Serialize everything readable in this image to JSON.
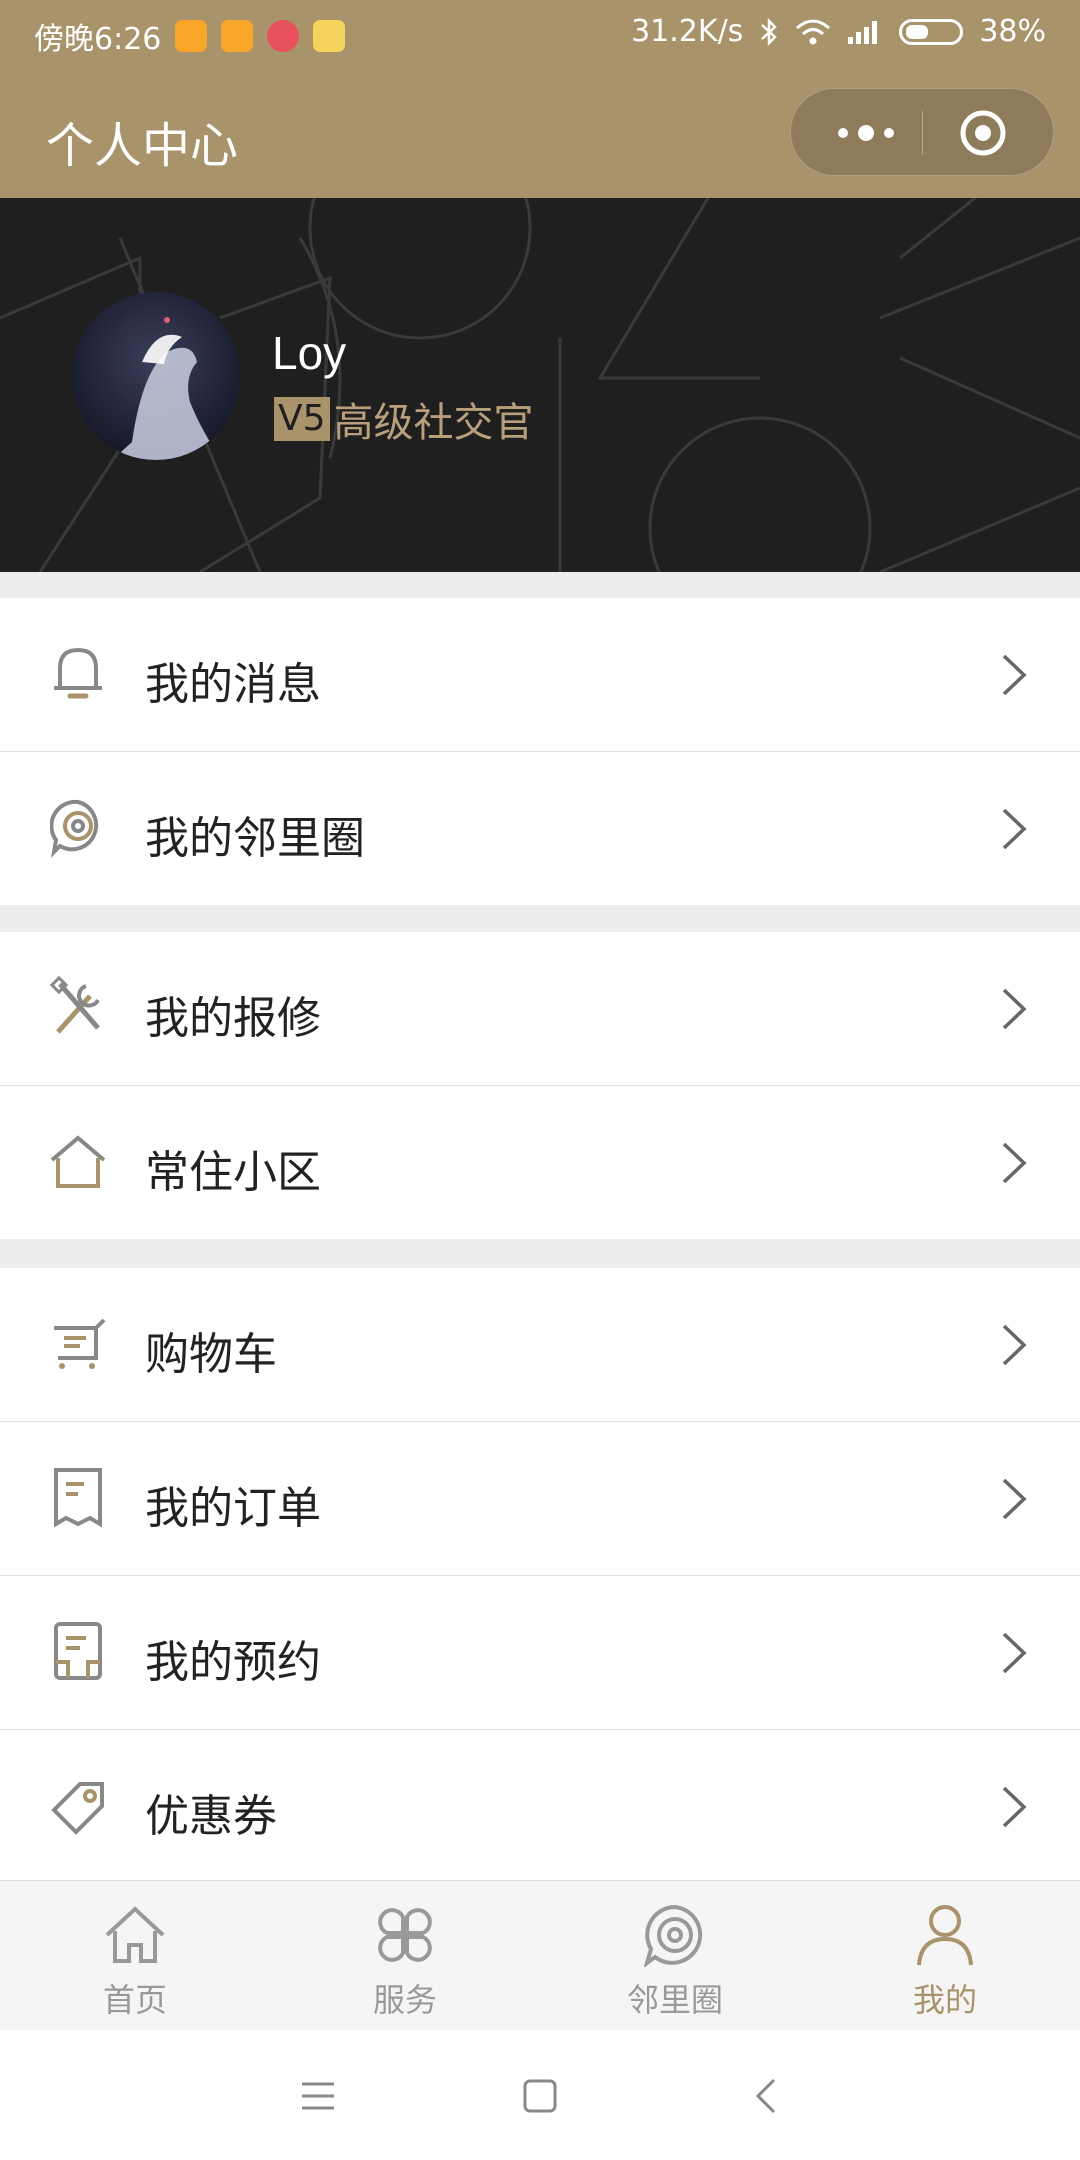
{
  "status_bar": {
    "time": "傍晚6:26",
    "network_speed": "31.2K/s",
    "battery": "38%",
    "notification_colors": [
      "#f7a628",
      "#f7a628",
      "#e8505b",
      "#f3d35c"
    ]
  },
  "header": {
    "title": "个人中心",
    "more_icon": "more-dots-icon",
    "close_icon": "target-icon"
  },
  "profile": {
    "name": "Loy",
    "level_badge": "V5",
    "level_title": "高级社交官"
  },
  "menu": {
    "group1": [
      {
        "label": "我的消息",
        "icon": "bell-icon"
      },
      {
        "label": "我的邻里圈",
        "icon": "neighbor-circle-icon"
      }
    ],
    "group2": [
      {
        "label": "我的报修",
        "icon": "repair-tools-icon"
      },
      {
        "label": "常住小区",
        "icon": "house-icon"
      }
    ],
    "group3": [
      {
        "label": "购物车",
        "icon": "cart-icon"
      },
      {
        "label": "我的订单",
        "icon": "order-receipt-icon"
      },
      {
        "label": "我的预约",
        "icon": "appointment-icon"
      },
      {
        "label": "优惠券",
        "icon": "coupon-tag-icon"
      }
    ]
  },
  "tabs": [
    {
      "label": "首页",
      "icon": "home-icon",
      "active": false
    },
    {
      "label": "服务",
      "icon": "services-icon",
      "active": false
    },
    {
      "label": "邻里圈",
      "icon": "neighbor-circle-icon",
      "active": false
    },
    {
      "label": "我的",
      "icon": "person-icon",
      "active": true
    }
  ],
  "colors": {
    "accent": "#a9936b",
    "hero_bg": "#1f1f1f",
    "inactive": "#999999"
  }
}
